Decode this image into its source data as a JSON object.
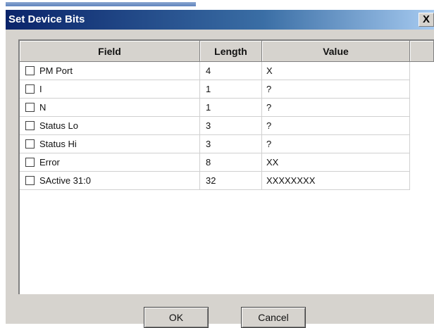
{
  "window": {
    "title": "Set Device Bits",
    "close_label": "X"
  },
  "table": {
    "headers": {
      "field": "Field",
      "length": "Length",
      "value": "Value"
    },
    "rows": [
      {
        "field": "PM Port",
        "length": "4",
        "value": "X",
        "checked": false
      },
      {
        "field": "I",
        "length": "1",
        "value": "?",
        "checked": false
      },
      {
        "field": "N",
        "length": "1",
        "value": "?",
        "checked": false
      },
      {
        "field": "Status Lo",
        "length": "3",
        "value": "?",
        "checked": false
      },
      {
        "field": "Status Hi",
        "length": "3",
        "value": "?",
        "checked": false
      },
      {
        "field": "Error",
        "length": "8",
        "value": "XX",
        "checked": false
      },
      {
        "field": "SActive 31:0",
        "length": "32",
        "value": "XXXXXXXX",
        "checked": false
      }
    ]
  },
  "buttons": {
    "ok": "OK",
    "cancel": "Cancel"
  }
}
